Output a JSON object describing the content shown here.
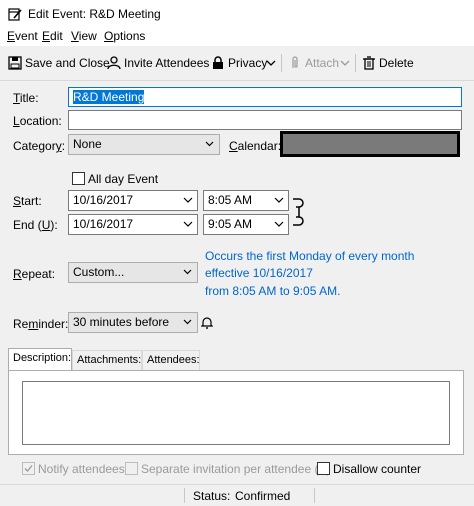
{
  "window": {
    "title": "Edit Event: R&D Meeting"
  },
  "menu": [
    "Event",
    "Edit",
    "View",
    "Options"
  ],
  "toolbar": {
    "save_close": "Save and Close",
    "invite": "Invite Attendees",
    "privacy": "Privacy",
    "attach": "Attach",
    "delete": "Delete"
  },
  "form": {
    "title_label": "Title:",
    "title_value": "R&D Meeting",
    "location_label": "Location:",
    "location_value": "",
    "category_label": "Category:",
    "category_value": "None",
    "calendar_label": "Calendar:",
    "allday_label": "All day Event",
    "start_label": "Start:",
    "start_date": "10/16/2017",
    "start_time": "8:05 AM",
    "end_label": "End (U):",
    "end_date": "10/16/2017",
    "end_time": "9:05 AM",
    "repeat_label": "Repeat:",
    "repeat_value": "Custom...",
    "repeat_details": [
      "Occurs the first Monday of every month",
      "effective 10/16/2017",
      "from 8:05 AM to 9:05 AM."
    ],
    "reminder_label": "Reminder:",
    "reminder_value": "30 minutes before"
  },
  "tabs": [
    "Description:",
    "Attachments:",
    "Attendees:"
  ],
  "options": {
    "notify": "Notify attendees",
    "separate": "Separate invitation per attendee (X)",
    "disallow": "Disallow counter"
  },
  "status": {
    "label": "Status:",
    "value": "Confirmed"
  },
  "colors": {
    "accent": "#0078d7",
    "link_blue": "#0066cc",
    "calendar_swatch": "#7a7a7a"
  }
}
